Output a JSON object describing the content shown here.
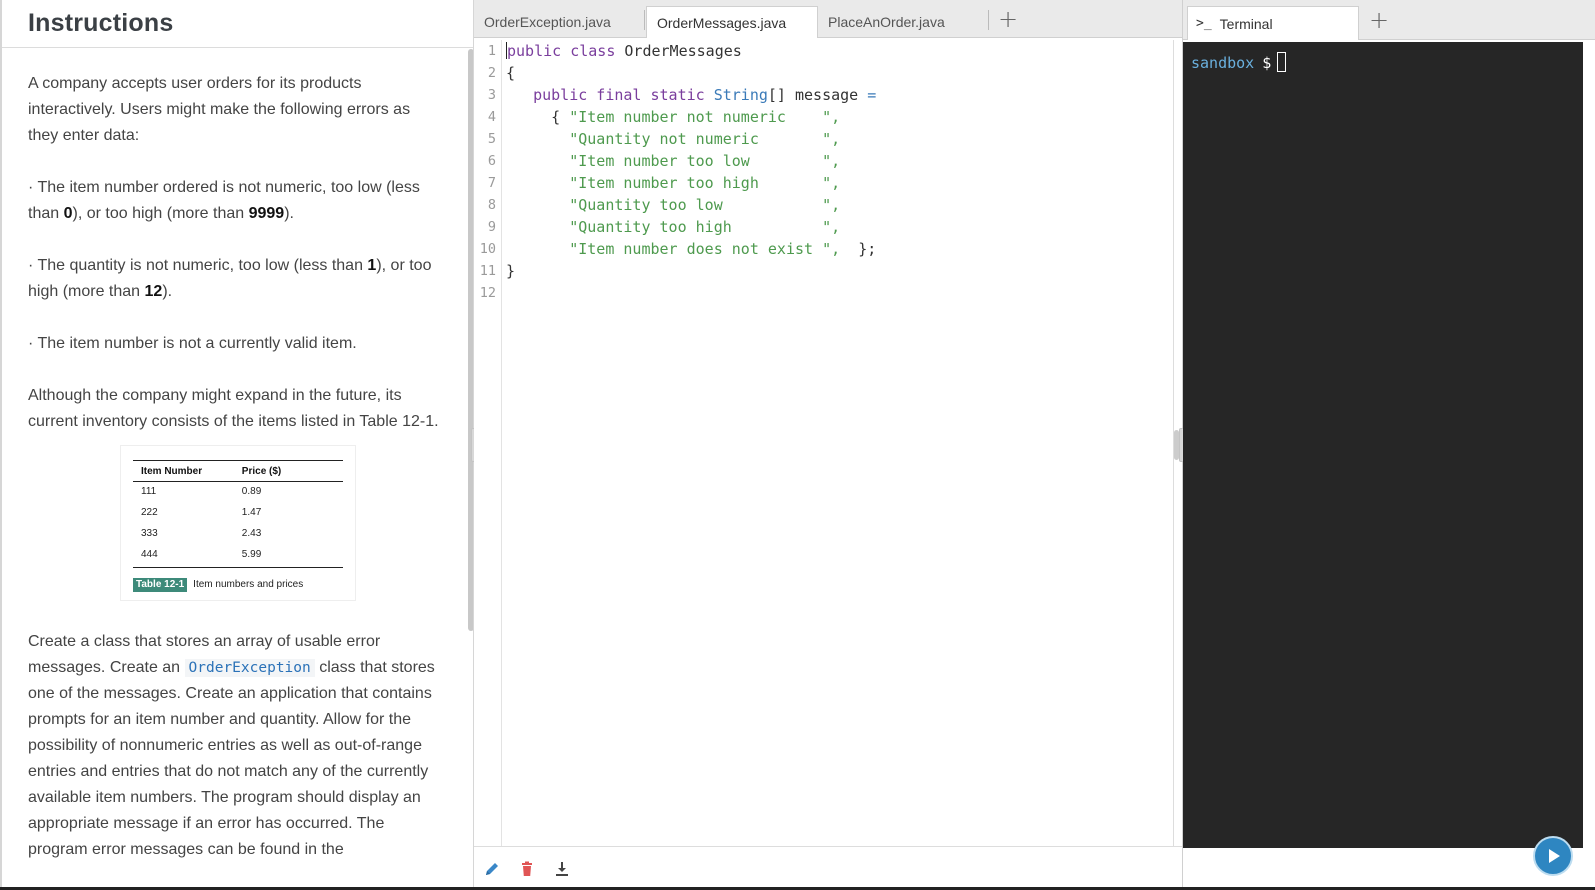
{
  "instructions": {
    "title": "Instructions",
    "intro": "A company accepts user orders for its products interactively. Users might make the following errors as they enter data:",
    "bullet1": {
      "text_a": "The item number ordered is not numeric, too low (less than ",
      "val_a": "0",
      "text_b": "), or too high (more than ",
      "val_b": "9999",
      "text_c": ")."
    },
    "bullet2": {
      "text_a": "The quantity is not numeric, too low (less than ",
      "val_a": "1",
      "text_b": "), or too high (more than ",
      "val_b": "12",
      "text_c": ")."
    },
    "bullet3": "The item number is not a currently valid item.",
    "inventory": "Although the company might expand in the future, its current inventory consists of the items listed in Table 12-1.",
    "table": {
      "headers": [
        "Item Number",
        "Price ($)"
      ],
      "rows": [
        [
          "111",
          "0.89"
        ],
        [
          "222",
          "1.47"
        ],
        [
          "333",
          "2.43"
        ],
        [
          "444",
          "5.99"
        ]
      ],
      "caption_label": "Table 12-1",
      "caption_text": "Item numbers and prices"
    },
    "task": {
      "text_a": "Create a class that stores an array of usable error messages. Create an ",
      "code": "OrderException",
      "text_b": " class that stores one of the messages. Create an application that contains prompts for an item number and quantity. Allow for the possibility of nonnumeric entries as well as out-of-range entries and entries that do not match any of the currently available item numbers. The program should display an appropriate message if an error has occurred. The program error messages can be found in the"
    }
  },
  "editor": {
    "tabs": [
      {
        "label": "OrderException.java",
        "active": false
      },
      {
        "label": "OrderMessages.java",
        "active": true
      },
      {
        "label": "PlaceAnOrder.java",
        "active": false
      }
    ],
    "line_numbers": [
      "1",
      "2",
      "3",
      "4",
      "5",
      "6",
      "7",
      "8",
      "9",
      "10",
      "11",
      "12"
    ],
    "code": {
      "l1_kw": "public class",
      "l1_name": " OrderMessages",
      "l2": "{",
      "l3_indent": "   ",
      "l3_kw": "public final static",
      "l3_type": " String",
      "l3_rest": "[] message ",
      "l3_op": "=",
      "l4_brace": "     { ",
      "strings": [
        "\"Item number not numeric    \"",
        "\"Quantity not numeric       \"",
        "\"Item number too low        \"",
        "\"Item number too high       \"",
        "\"Quantity too low           \"",
        "\"Quantity too high          \"",
        "\"Item number does not exist \""
      ],
      "comma": ",",
      "closing": "  };",
      "l11": "}"
    },
    "toolbar": [
      "pencil-icon",
      "trash-icon",
      "download-icon"
    ],
    "colors": {
      "keyword": "#7a3e9d",
      "type": "#3a7ab8",
      "string": "#4e9a4e"
    }
  },
  "terminal": {
    "tab_icon": ">_",
    "tab_label": "Terminal",
    "prompt_host": "sandbox",
    "prompt_symbol": "$"
  },
  "add_tab_symbol": "+"
}
